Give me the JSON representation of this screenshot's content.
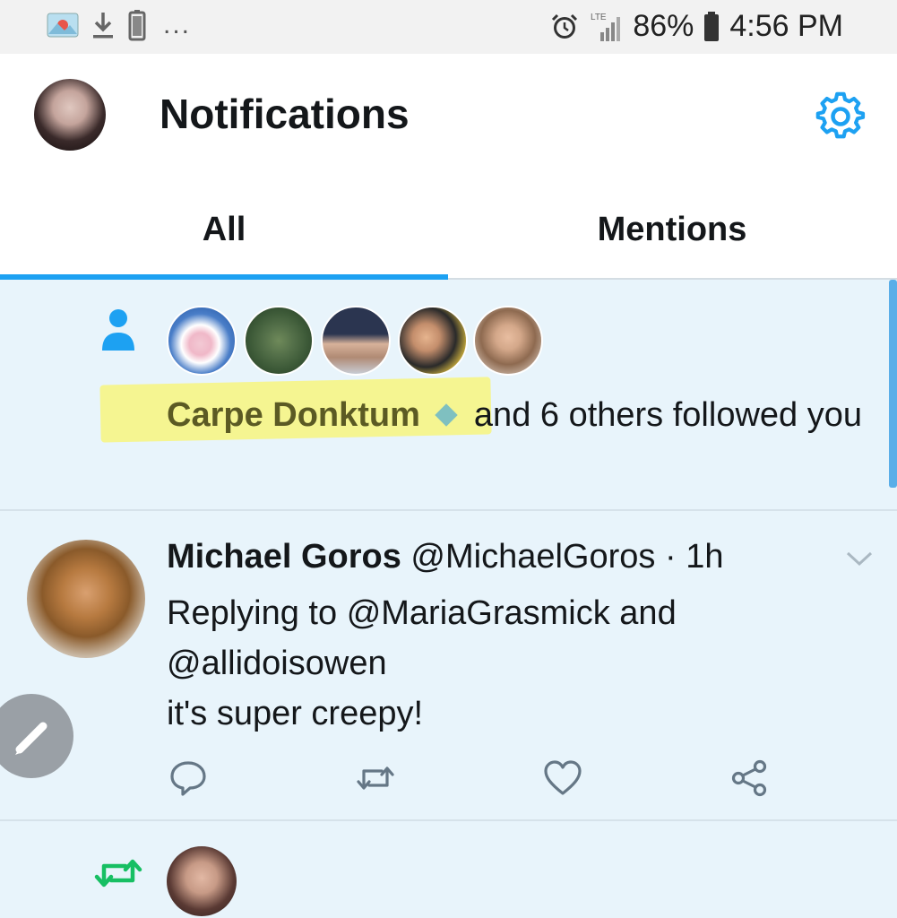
{
  "status_bar": {
    "dots": "...",
    "battery_pct": "86%",
    "time": "4:56 PM",
    "network": "LTE"
  },
  "header": {
    "title": "Notifications"
  },
  "tabs": [
    {
      "label": "All",
      "selected": true
    },
    {
      "label": "Mentions",
      "selected": false
    }
  ],
  "follow_notification": {
    "name": "Carpe Donktum",
    "rest": "and 6 others followed you"
  },
  "tweet": {
    "author_name": "Michael Goros",
    "handle": "@MichaelGoros",
    "separator": "·",
    "time": "1h",
    "replying_prefix": "Replying to",
    "reply_handle_1": "@MariaGrasmick",
    "reply_and": "and",
    "reply_handle_2": "@allidoisowen",
    "text": "it's super creepy!"
  },
  "colors": {
    "accent": "#1da1f2",
    "retweet_green": "#17bf63",
    "highlight": "#faf56e"
  },
  "icons": [
    "gallery-icon",
    "download-icon",
    "battery-icon",
    "alarm-icon",
    "signal-icon",
    "gear-icon",
    "person-icon",
    "reply-icon",
    "retweet-icon",
    "like-icon",
    "share-icon",
    "compose-icon",
    "chevron-down-icon"
  ]
}
